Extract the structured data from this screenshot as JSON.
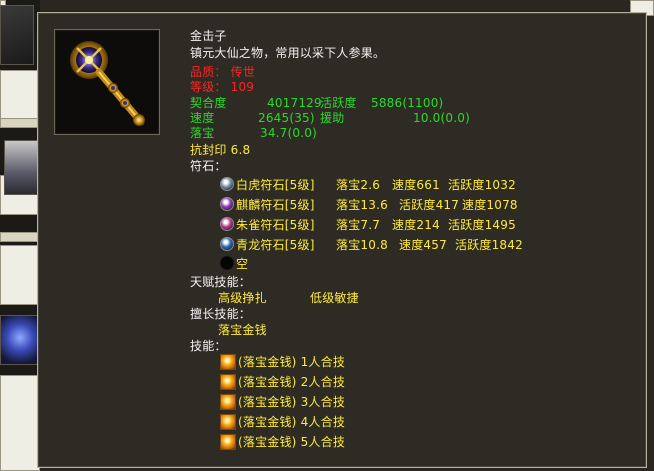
{
  "item": {
    "name": "金击子",
    "description": "镇元大仙之物，常用以采下人参果。",
    "quality_label": "品质：",
    "quality_value": "传世",
    "level_label": "等级：",
    "level_value": "109",
    "fit_label": "契合度",
    "fit_value": "4017129",
    "activity_label": "活跃度",
    "activity_value": "5886(1100)",
    "speed_label": "速度",
    "speed_value": "2645(35)",
    "assist_label": "援助",
    "assist_value": "10.0(0.0)",
    "loot_label": "落宝",
    "loot_value": "34.7(0.0)",
    "seal_resist": "抗封印 6.8"
  },
  "runes": {
    "header": "符石：",
    "items": [
      {
        "name": "白虎符石[5级]",
        "loot": "落宝2.6",
        "speed": "速度661",
        "activity": "活跃度1032",
        "icon": "white-tiger-rune-icon",
        "color": "#7a8fa8"
      },
      {
        "name": "麒麟符石[5级]",
        "loot": "落宝13.6",
        "speed": "活跃度417",
        "activity": "速度1078",
        "icon": "qilin-rune-icon",
        "color": "#8a3ab8"
      },
      {
        "name": "朱雀符石[5级]",
        "loot": "落宝7.7",
        "speed": "速度214",
        "activity": "活跃度1495",
        "icon": "vermilion-bird-rune-icon",
        "color": "#b83a8a"
      },
      {
        "name": "青龙符石[5级]",
        "loot": "落宝10.8",
        "speed": "速度457",
        "activity": "活跃度1842",
        "icon": "azure-dragon-rune-icon",
        "color": "#2a6ab8"
      }
    ],
    "empty_label": "空",
    "empty_icon": "empty-slot-icon"
  },
  "talent": {
    "header": "天赋技能：",
    "skill_1": "高级挣扎",
    "skill_2": "低级敏捷"
  },
  "specialty": {
    "header": "擅长技能：",
    "skill": "落宝金钱"
  },
  "skills": {
    "header": "技能：",
    "items": [
      "(落宝金钱) 1人合技",
      "(落宝金钱) 2人合技",
      "(落宝金钱) 3人合技",
      "(落宝金钱) 4人合技",
      "(落宝金钱) 5人合技"
    ],
    "icon": "gold-coin-skill-icon"
  }
}
